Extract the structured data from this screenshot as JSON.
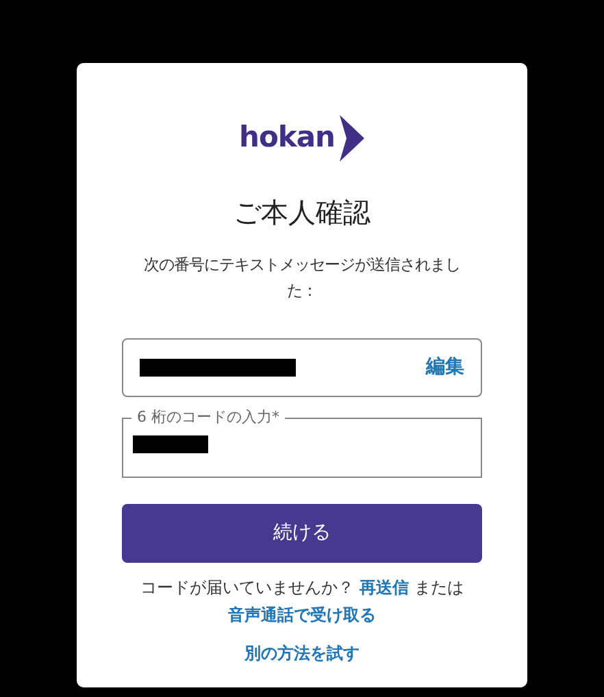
{
  "logo": {
    "text": "hokan"
  },
  "title": "ご本人確認",
  "message": "次の番号にテキストメッセージが送信されました：",
  "phone_field": {
    "value_redacted": true,
    "action": "編集"
  },
  "code_field": {
    "label": "6 桁のコードの入力*",
    "value_redacted": true
  },
  "continue_button": "続ける",
  "resend": {
    "prefix": "コードが届いていませんか？",
    "link": "再送信",
    "suffix": "または",
    "voice_link": "音声通話で受け取る"
  },
  "alt_link": "別の方法を試す"
}
